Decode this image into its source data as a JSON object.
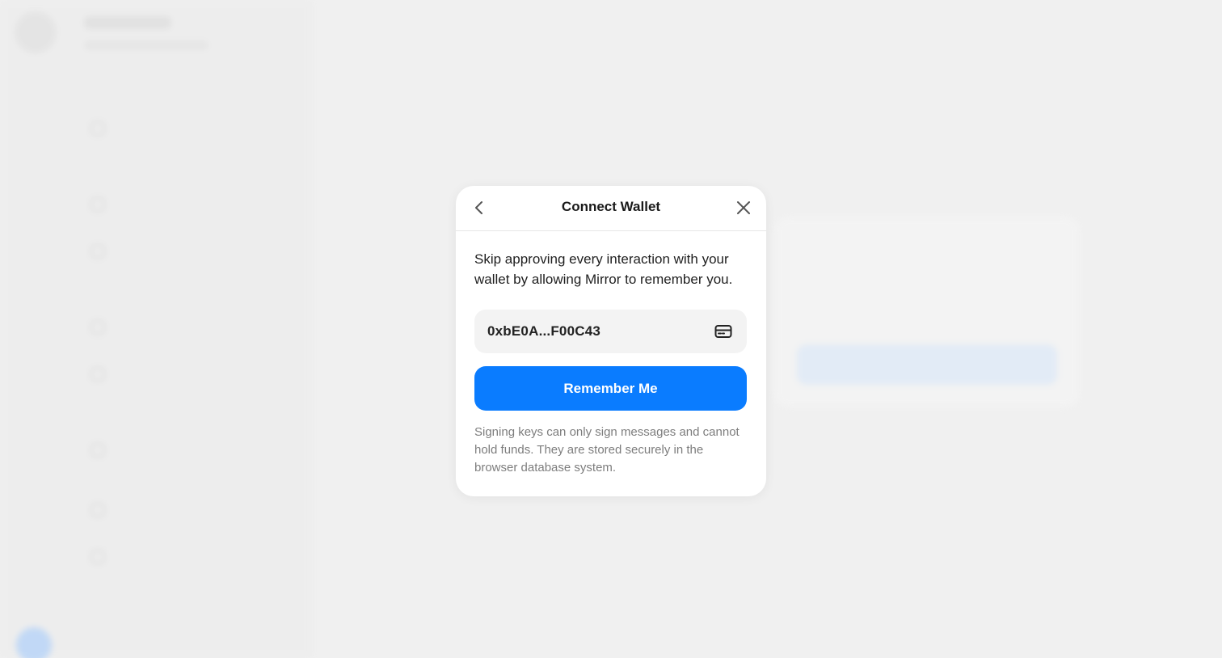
{
  "modal": {
    "title": "Connect Wallet",
    "description": "Skip approving every interaction with your wallet by allowing Mirror to remember you.",
    "wallet_address": "0xbE0A...F00C43",
    "remember_label": "Remember Me",
    "note": "Signing keys can only sign messages and cannot hold funds. They are stored securely in the browser database system.",
    "back_icon": "chevron-left-icon",
    "close_icon": "close-icon",
    "wallet_icon": "wallet-icon",
    "accent_color": "#0a7cff"
  }
}
